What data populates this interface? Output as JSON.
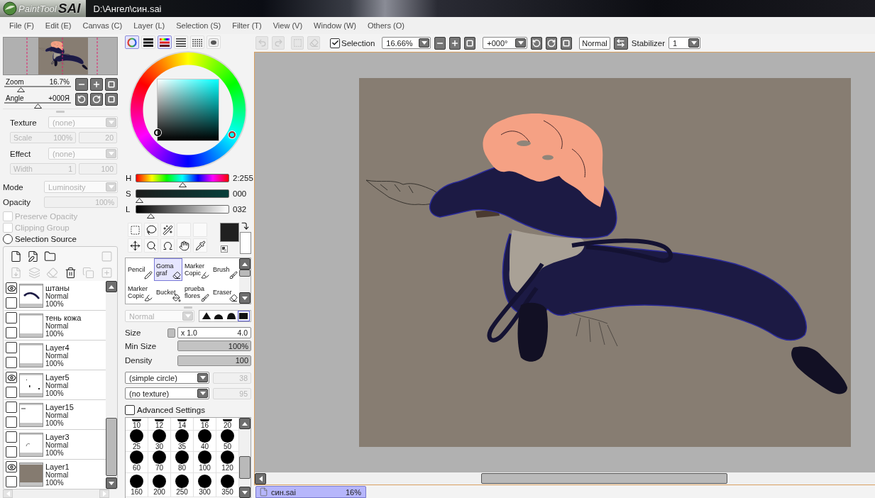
{
  "title_bar": {
    "app_name": "PaintTool",
    "app_name_bold": "SAI",
    "file_path": "D:\\Ангел\\син.sai"
  },
  "menu": [
    "File (F)",
    "Edit (E)",
    "Canvas (C)",
    "Layer (L)",
    "Selection (S)",
    "Filter (T)",
    "View (V)",
    "Window (W)",
    "Others (O)"
  ],
  "navigator": {
    "zoom": {
      "label": "Zoom",
      "value": "16.7%",
      "level": 0.22
    },
    "angle": {
      "label": "Angle",
      "value": "+000Я",
      "level": 0.5
    }
  },
  "layer_properties": {
    "texture": {
      "label": "Texture",
      "value": "(none)",
      "disabled": true
    },
    "scale": {
      "label": "Scale",
      "value": "100%",
      "value_2": "20",
      "disabled": true
    },
    "effect": {
      "label": "Effect",
      "value": "(none)",
      "disabled": true
    },
    "width": {
      "label": "Width",
      "value": "1",
      "value_2": "100",
      "disabled": true
    },
    "mode": {
      "label": "Mode",
      "value": "Luminosity",
      "disabled": true
    },
    "opacity": {
      "label": "Opacity",
      "value": "100%",
      "disabled": true
    },
    "options": [
      {
        "kind": "checkbox",
        "label": "Preserve Opacity",
        "checked": false,
        "disabled": true
      },
      {
        "kind": "checkbox",
        "label": "Clipping Group",
        "checked": false,
        "disabled": true
      },
      {
        "kind": "radio",
        "label": "Selection Source",
        "checked": false,
        "disabled": false
      }
    ]
  },
  "layer_buttons_top": [
    {
      "kind": "new-layer",
      "disabled": false
    },
    {
      "kind": "new-vector-layer",
      "disabled": false
    },
    {
      "kind": "new-folder",
      "disabled": false
    },
    {
      "kind": "new-mask",
      "disabled": true
    }
  ],
  "layer_buttons_bottom": [
    {
      "kind": "transfer-down",
      "disabled": true
    },
    {
      "kind": "merge-down",
      "disabled": true
    },
    {
      "kind": "clear-layer",
      "disabled": true
    },
    {
      "kind": "delete-layer",
      "disabled": false
    },
    {
      "kind": "merge-visible",
      "disabled": true
    },
    {
      "kind": "apply-mask",
      "disabled": true
    }
  ],
  "layers": [
    {
      "name": "штаны",
      "blend": "Normal",
      "opacity": "100%",
      "visible": true,
      "kind": "stroke"
    },
    {
      "name": "тень кожа",
      "blend": "Normal",
      "opacity": "100%",
      "visible": false,
      "kind": "blank"
    },
    {
      "name": "Layer4",
      "blend": "Normal",
      "opacity": "100%",
      "visible": false,
      "kind": "blank"
    },
    {
      "name": "Layer5",
      "blend": "Normal",
      "opacity": "100%",
      "visible": true,
      "kind": "specks"
    },
    {
      "name": "Layer15",
      "blend": "Normal",
      "opacity": "100%",
      "visible": false,
      "kind": "dash"
    },
    {
      "name": "Layer3",
      "blend": "Normal",
      "opacity": "100%",
      "visible": false,
      "kind": "curve"
    },
    {
      "name": "Layer1",
      "blend": "Normal",
      "opacity": "100%",
      "visible": true,
      "kind": "fill"
    }
  ],
  "color_tabs": [
    {
      "kind": "wheel",
      "selected": true
    },
    {
      "kind": "rgb",
      "selected": false
    },
    {
      "kind": "hsv",
      "selected": true
    },
    {
      "kind": "list",
      "selected": false
    },
    {
      "kind": "swatches",
      "selected": false
    },
    {
      "kind": "scratchpad",
      "selected": false
    }
  ],
  "color_sliders": [
    {
      "kind": "hue",
      "label": "H",
      "value": "2:255",
      "level": 0.5
    },
    {
      "kind": "saturation",
      "label": "S",
      "value": "000",
      "level": 0
    },
    {
      "kind": "lightness",
      "label": "L",
      "value": "032",
      "level": 0.13
    }
  ],
  "tools": [
    {
      "kind": "rect-select"
    },
    {
      "kind": "lasso"
    },
    {
      "kind": "magic-wand"
    },
    {
      "kind": "empty"
    },
    {
      "kind": "empty"
    },
    {
      "kind": "move"
    },
    {
      "kind": "zoom"
    },
    {
      "kind": "rotate"
    },
    {
      "kind": "hand"
    },
    {
      "kind": "eyedropper"
    }
  ],
  "color_swatches": [
    {
      "color": "#202020"
    },
    {
      "color": "#ffffff"
    }
  ],
  "brushes": [
    {
      "name": "Pencil",
      "kind": "pencil",
      "selected": false
    },
    {
      "name": "Goma graf",
      "kind": "eraser",
      "selected": true
    },
    {
      "name": "Marker Copic",
      "kind": "marker",
      "selected": false
    },
    {
      "name": "Brush",
      "kind": "brush",
      "selected": false
    },
    {
      "name": "Marker Copic",
      "kind": "marker",
      "selected": false
    },
    {
      "name": "Bucket",
      "kind": "bucket",
      "selected": false
    },
    {
      "name": "prueba flores",
      "kind": "brush",
      "selected": false
    },
    {
      "name": "Eraser",
      "kind": "eraser",
      "selected": false
    }
  ],
  "brush_settings": {
    "blend_mode": {
      "value": "Normal",
      "disabled": true
    },
    "edge_shapes": [
      {
        "kind": "sharp",
        "selected": false
      },
      {
        "kind": "round",
        "selected": false
      },
      {
        "kind": "flat",
        "selected": false
      },
      {
        "kind": "solid",
        "selected": true
      }
    ],
    "size": {
      "label": "Size",
      "multiplier": "x 1.0",
      "value": "4.0"
    },
    "min_size": {
      "label": "Min Size",
      "value": "100%",
      "level": 1
    },
    "density": {
      "label": "Density",
      "value": "100",
      "level": 1
    },
    "shape": {
      "value": "(simple circle)",
      "strength": "38",
      "strength_disabled": true
    },
    "texture": {
      "value": "(no texture)",
      "strength": "95",
      "strength_disabled": true
    },
    "advanced": {
      "label": "Advanced Settings",
      "checked": false
    }
  },
  "brush_sizes": [
    "10",
    "12",
    "14",
    "16",
    "20",
    "25",
    "30",
    "35",
    "40",
    "50",
    "60",
    "70",
    "80",
    "100",
    "120",
    "160",
    "200",
    "250",
    "300",
    "350"
  ],
  "canvas_toolbar": {
    "history_buttons": [
      {
        "kind": "undo",
        "disabled": true
      },
      {
        "kind": "redo",
        "disabled": true
      },
      {
        "kind": "deselect",
        "disabled": true
      },
      {
        "kind": "clear",
        "disabled": true
      }
    ],
    "selection": {
      "label": "Selection",
      "checked": true
    },
    "zoom": "16.66%",
    "angle": "+000°",
    "blend": "Normal",
    "stabilizer": {
      "label": "Stabilizer",
      "value": "1"
    }
  },
  "document_tabs": [
    {
      "name": "син.sai",
      "zoom": "16%",
      "selected": true
    }
  ]
}
